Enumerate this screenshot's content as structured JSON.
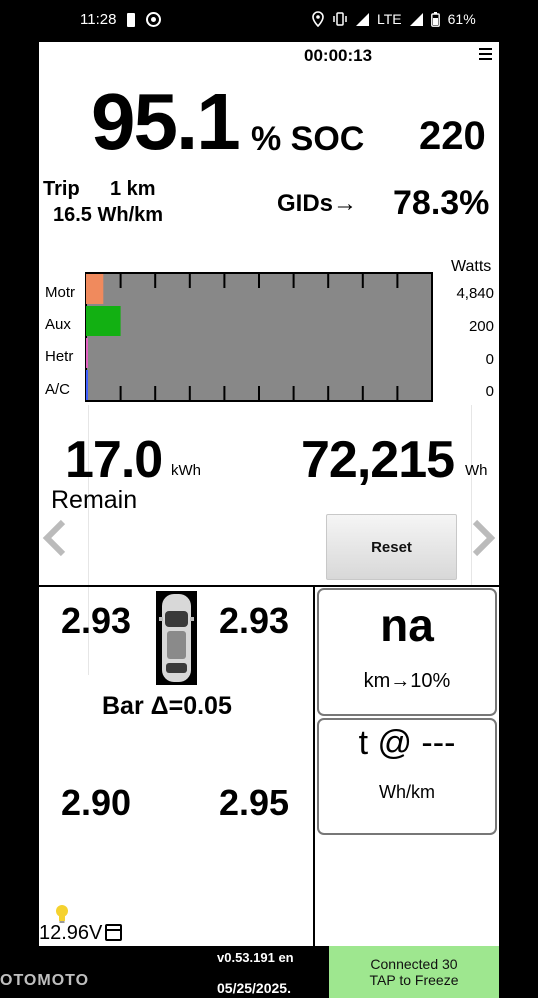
{
  "status_bar": {
    "time": "11:28",
    "network": "LTE",
    "battery": "61%"
  },
  "header": {
    "timer": "00:00:13"
  },
  "soc": {
    "value": "95.1",
    "unit": "% SOC",
    "right_value": "220"
  },
  "trip": {
    "label": "Trip",
    "distance": "1 km",
    "efficiency": "16.5 Wh/km"
  },
  "gids": {
    "label": "GIDs→",
    "value": "78.3%"
  },
  "chart_data": {
    "type": "bar",
    "orientation": "horizontal",
    "title": "",
    "ylabel_right": "Watts",
    "categories": [
      "Motr",
      "Aux",
      "Hetr",
      "A/C"
    ],
    "values": [
      4840,
      200,
      0,
      0
    ],
    "value_labels": [
      "4,840",
      "200",
      "0",
      "0"
    ],
    "bar_fractions": [
      0.05,
      0.1,
      0.005,
      0.005
    ],
    "colors": [
      "#f08a5d",
      "#12b012",
      "#e060c0",
      "#4060ff"
    ],
    "background": "#888888",
    "grid_ticks": 10
  },
  "energy": {
    "remain_value": "17.0",
    "remain_unit": "kWh",
    "remain_label": "Remain",
    "wh_value": "72,215",
    "wh_unit": "Wh",
    "reset_label": "Reset"
  },
  "tires": {
    "front_left": "2.93",
    "front_right": "2.93",
    "rear_left": "2.90",
    "rear_right": "2.95",
    "delta_label": "Bar  Δ=0.05"
  },
  "battery_12v": {
    "voltage": "12.96V"
  },
  "range_card": {
    "value": "na",
    "label": "km→10%"
  },
  "time_card": {
    "value": "t @ ---",
    "label": "Wh/km"
  },
  "bottom_bar": {
    "version": "v0.53.191 en",
    "date": "05/25/2025.",
    "freeze_line1": "Connected 30",
    "freeze_line2": "TAP to Freeze"
  },
  "watermark": "OTOMOTO",
  "icons": [
    "phone-icon",
    "cast-icon",
    "location-icon",
    "vibrate-icon",
    "signal-icon",
    "battery-icon",
    "menu-icon",
    "chevron-left-icon",
    "chevron-right-icon",
    "car-icon",
    "bulb-icon",
    "calendar-icon"
  ]
}
